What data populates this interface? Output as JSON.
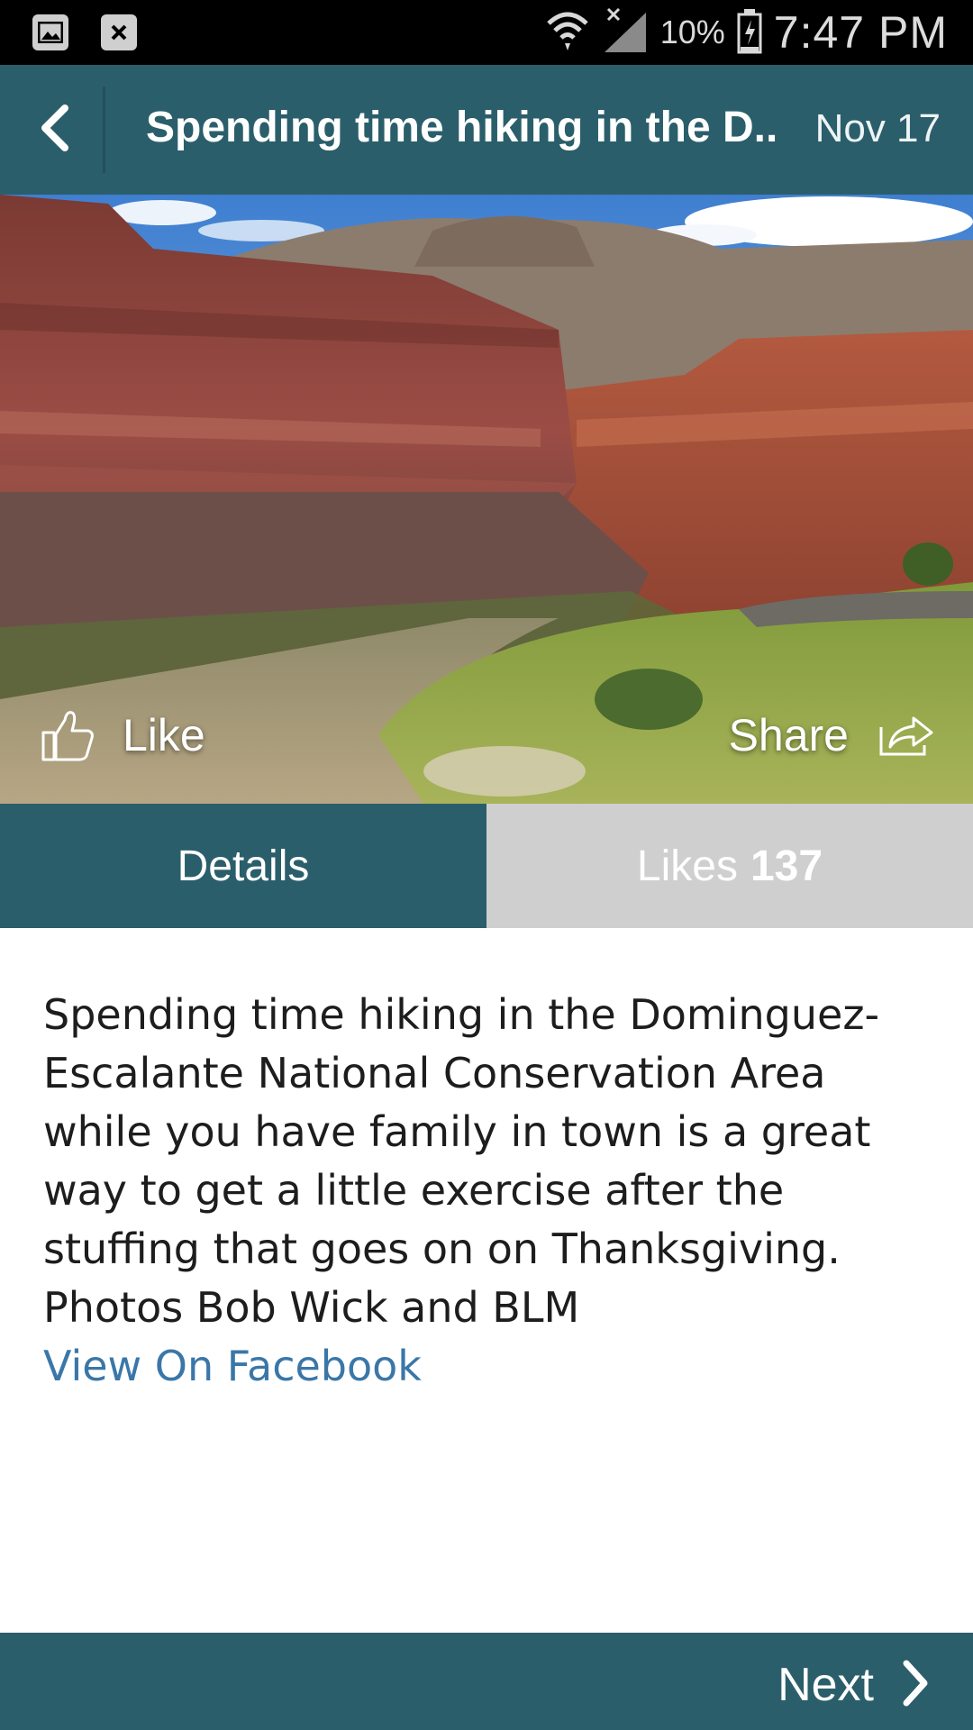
{
  "status_bar": {
    "battery": "10%",
    "time": "7:47 PM",
    "icons": [
      "gallery-icon",
      "close-notification-icon",
      "wifi-icon",
      "signal-icon",
      "battery-icon"
    ]
  },
  "app_bar": {
    "title": "Spending time hiking in the D..",
    "date": "Nov 17",
    "back_icon": "chevron-left-icon"
  },
  "photo": {
    "description_icon": "photo",
    "like_label": "Like",
    "share_label": "Share"
  },
  "tabs": {
    "details_label": "Details",
    "likes_label": "Likes",
    "likes_count": "137"
  },
  "post": {
    "text": "Spending time hiking in the Dominguez-Escalante National Conservation Area while you have family in town is a great way to get a little exercise after the stuffing that goes on on Thanksgiving. Photos Bob Wick and BLM",
    "link_label": "View On Facebook"
  },
  "footer": {
    "next_label": "Next"
  },
  "colors": {
    "primary": "#2b5e6b",
    "tab_inactive": "#cfcfcf",
    "link": "#3a77a8"
  }
}
